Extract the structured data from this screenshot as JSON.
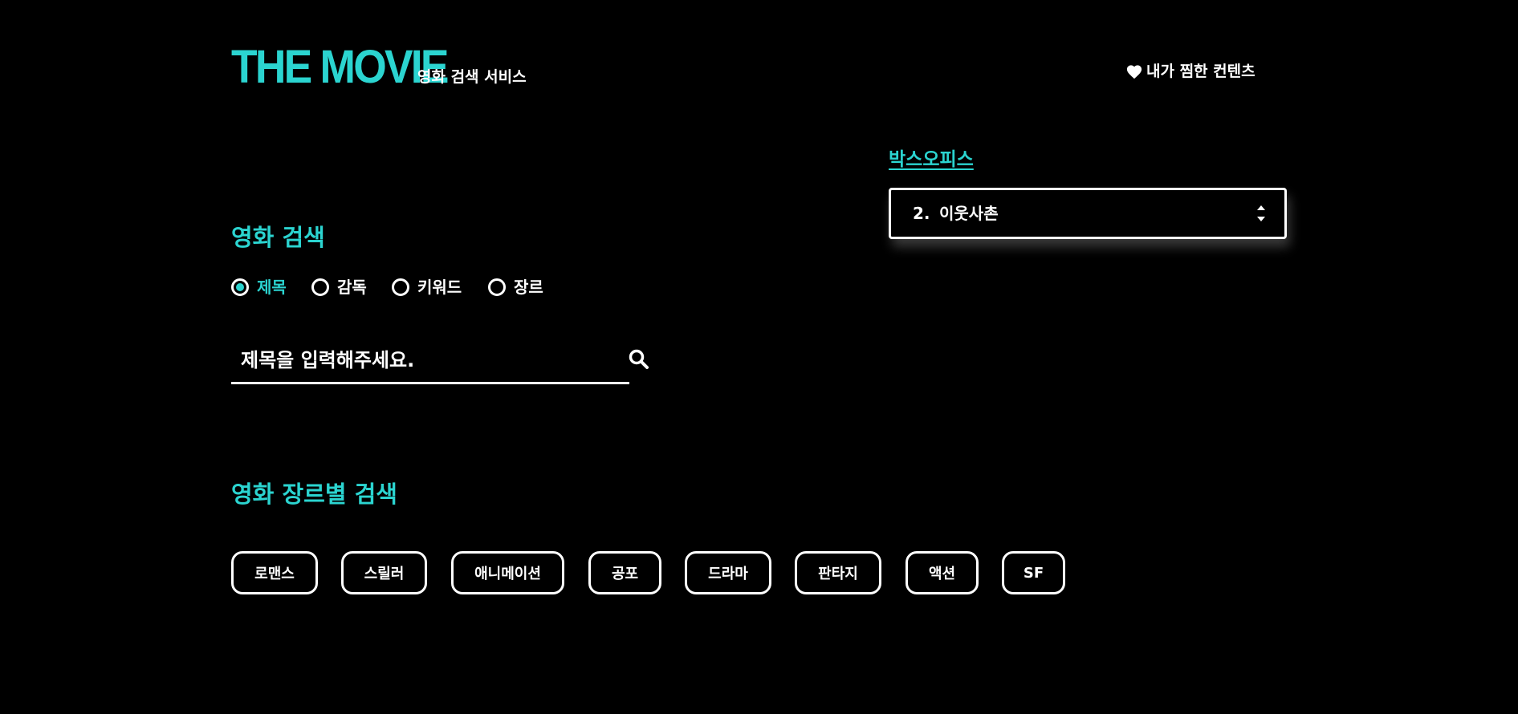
{
  "header": {
    "logo": "THE MOVIE",
    "subtitle": "영화 검색 서비스",
    "favorites_label": "내가 찜한 컨텐츠",
    "favorites_icon": "heart-icon"
  },
  "boxoffice": {
    "title": "박스오피스",
    "selected_rank": "2.",
    "selected_title": "이웃사촌",
    "arrows_icon": "sort-arrows-icon"
  },
  "search": {
    "title": "영화 검색",
    "options": [
      "제목",
      "감독",
      "키워드",
      "장르"
    ],
    "selected_option": "제목",
    "placeholder": "제목을 입력해주세요.",
    "button_icon": "search-icon"
  },
  "genre_search": {
    "title": "영화 장르별 검색",
    "genres": [
      "로맨스",
      "스릴러",
      "애니메이션",
      "공포",
      "드라마",
      "판타지",
      "액션",
      "SF"
    ]
  },
  "colors": {
    "accent": "#2bd4d0",
    "background": "#000000",
    "text": "#ffffff"
  }
}
